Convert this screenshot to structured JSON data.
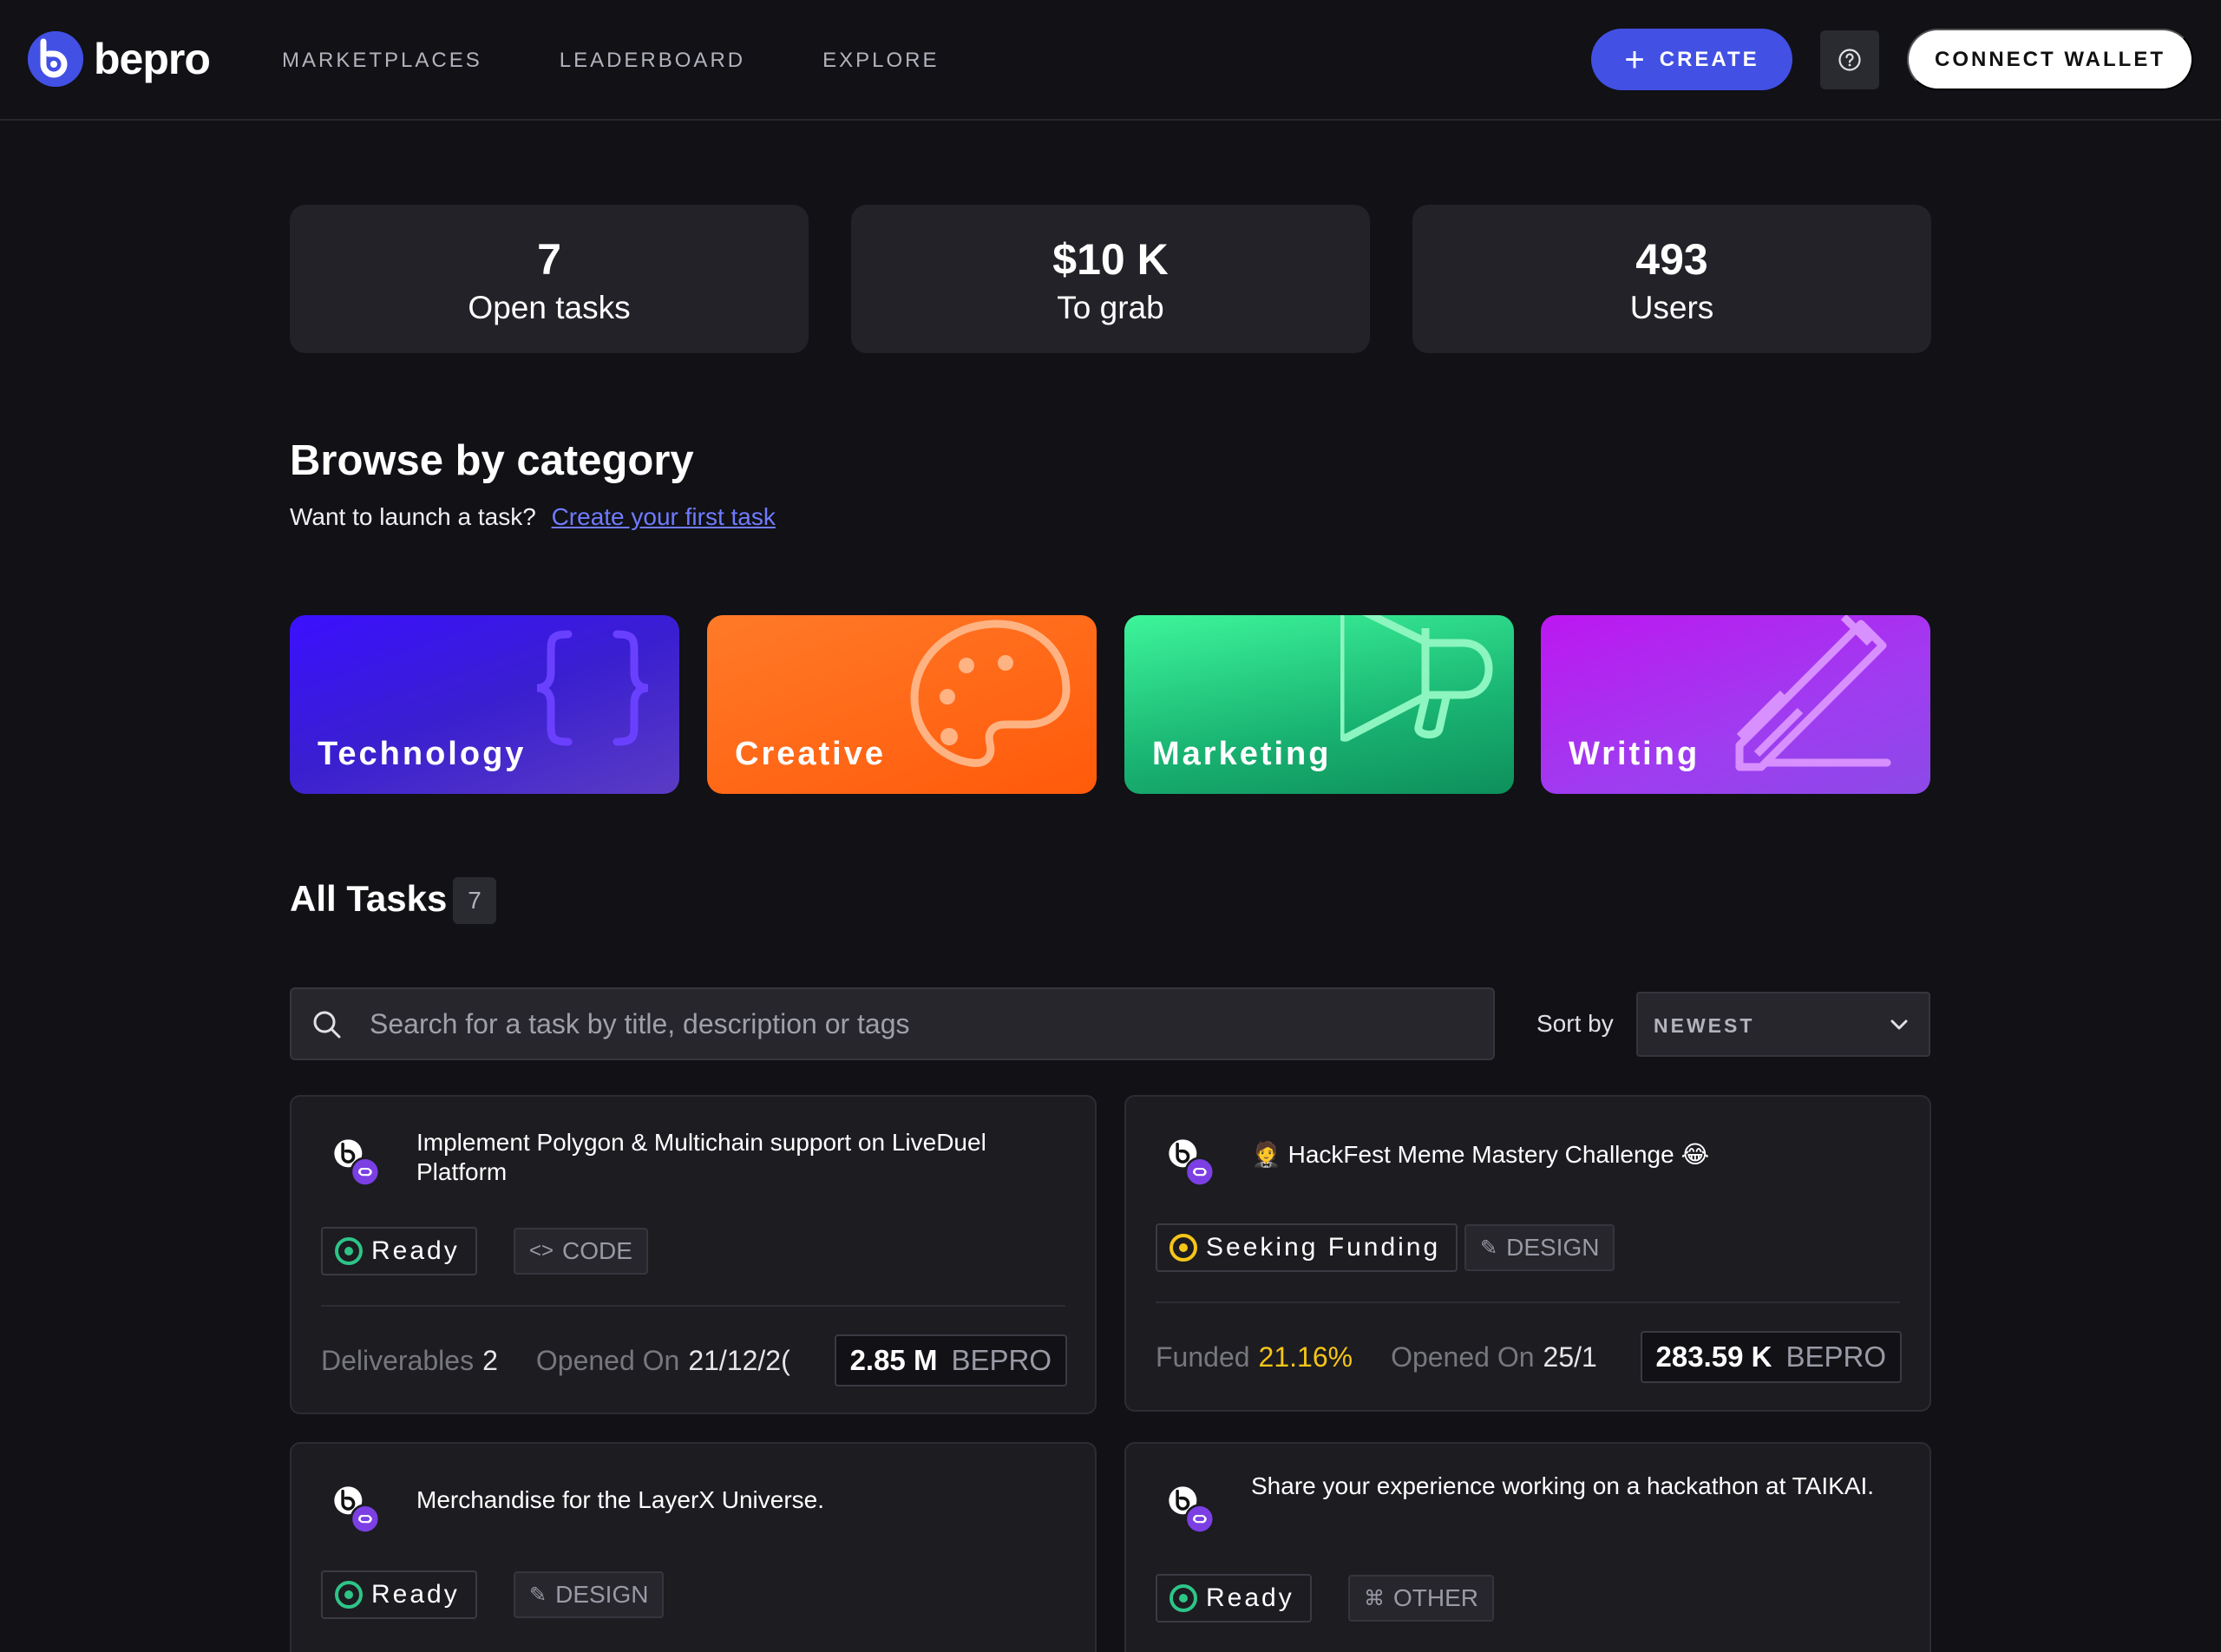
{
  "header": {
    "logo_text": "bepro",
    "nav": [
      "MARKETPLACES",
      "LEADERBOARD",
      "EXPLORE"
    ],
    "create_label": "CREATE",
    "connect_label": "CONNECT WALLET",
    "accent": "#4250e4"
  },
  "stats": [
    {
      "value": "7",
      "label": "Open tasks"
    },
    {
      "value": "$10 K",
      "label": "To grab"
    },
    {
      "value": "493",
      "label": "Users"
    }
  ],
  "browse": {
    "title": "Browse by category",
    "prompt": "Want to launch a task?",
    "link": "Create your first task"
  },
  "categories": [
    {
      "label": "Technology",
      "icon": "braces-icon"
    },
    {
      "label": "Creative",
      "icon": "palette-icon"
    },
    {
      "label": "Marketing",
      "icon": "megaphone-icon"
    },
    {
      "label": "Writing",
      "icon": "pencil-icon"
    }
  ],
  "tasks": {
    "title": "All Tasks",
    "count": "7",
    "search_placeholder": "Search for a task by title, description or tags",
    "sort_label": "Sort by",
    "sort_value": "NEWEST",
    "cards": [
      {
        "title": "Implement Polygon & Multichain support on LiveDuel Platform",
        "status": "Ready",
        "tag": "CODE",
        "meta1_label": "Deliverables",
        "meta1_value": "2",
        "opened_label": "Opened On",
        "opened_value": "21/12/2(",
        "amount": "2.85 M",
        "currency": "BEPRO"
      },
      {
        "title": "🤵 HackFest Meme Mastery Challenge 😂",
        "status": "Seeking Funding",
        "tag": "DESIGN",
        "meta1_label": "Funded",
        "meta1_value": "21.16%",
        "opened_label": "Opened On",
        "opened_value": "25/1",
        "amount": "283.59 K",
        "currency": "BEPRO"
      },
      {
        "title": "Merchandise for the LayerX Universe.",
        "status": "Ready",
        "tag": "DESIGN"
      },
      {
        "title": "Share your experience working on a hackathon at TAIKAI.",
        "status": "Ready",
        "tag": "OTHER"
      }
    ]
  }
}
